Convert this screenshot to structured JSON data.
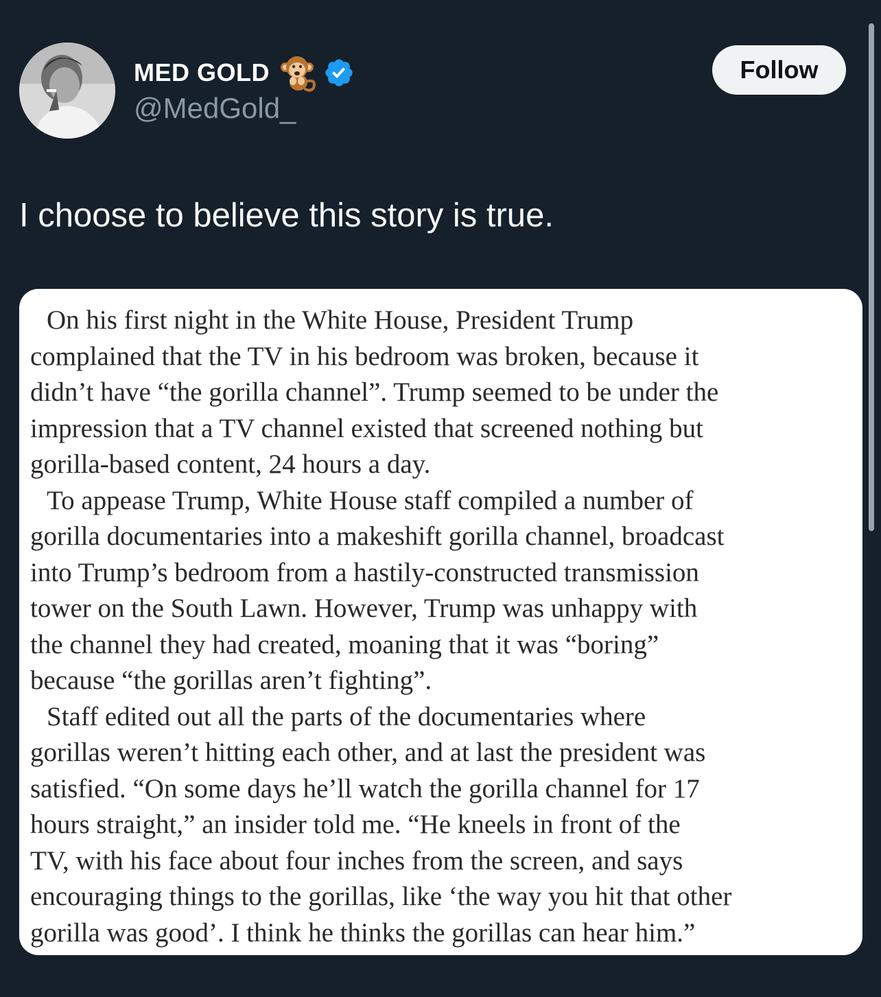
{
  "author": {
    "display_name": "MED GOLD",
    "handle": "@MedGold_",
    "name_emoji": "monkey-emoji",
    "verified_badge": "verified-check-icon",
    "badge_color": "#1d9bf0"
  },
  "follow": {
    "label": "Follow"
  },
  "tweet": {
    "text": "I choose to believe this story is true."
  },
  "quoted_image": {
    "lines": [
      "On his first night in the White House, President Trump",
      "complained that the TV in his bedroom was broken, because it",
      "didn’t have “the gorilla channel”. Trump seemed to be under the",
      "impression that a TV channel existed that screened nothing but",
      "gorilla-based content, 24 hours a day.",
      "To appease Trump, White House staff compiled a number of",
      "gorilla documentaries into a makeshift gorilla channel, broadcast",
      "into Trump’s bedroom from a hastily-constructed transmission",
      "tower on the South Lawn. However, Trump was unhappy with",
      "the channel they had created, moaning that it was “boring”",
      "because “the gorillas aren’t fighting”.",
      "Staff edited out all the parts of the documentaries where",
      "gorillas weren’t hitting each other, and at last the president was",
      "satisfied. “On some days he’ll watch the gorilla channel for 17",
      "hours straight,” an insider told me. “He kneels in front of the",
      "TV, with his face about four inches from the screen, and says",
      "encouraging things to the gorillas, like ‘the way you hit that other",
      "gorilla was good’. I think he thinks the gorillas can hear him.”"
    ]
  },
  "colors": {
    "background": "#15202b",
    "text_primary": "#f7f9f9",
    "text_secondary": "#8b98a5",
    "button_bg": "#eff3f4"
  }
}
